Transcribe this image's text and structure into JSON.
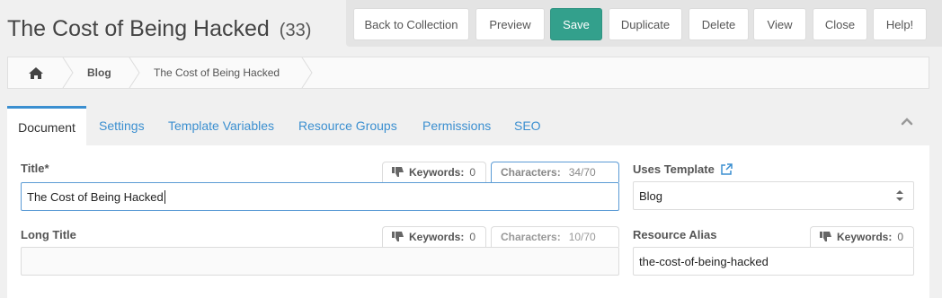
{
  "header": {
    "title": "The Cost of Being Hacked",
    "count": "(33)"
  },
  "toolbar": {
    "back": "Back to Collection",
    "preview": "Preview",
    "save": "Save",
    "duplicate": "Duplicate",
    "delete": "Delete",
    "view": "View",
    "close": "Close",
    "help": "Help!"
  },
  "breadcrumb": {
    "blog": "Blog",
    "current": "The Cost of Being Hacked"
  },
  "tabs": [
    "Document",
    "Settings",
    "Template Variables",
    "Resource Groups",
    "Permissions",
    "SEO"
  ],
  "form": {
    "title": {
      "label": "Title*",
      "value": "The Cost of Being Hacked",
      "keywords_label": "Keywords:",
      "keywords_value": "0",
      "characters_label": "Characters:",
      "characters_value": "34/70"
    },
    "long_title": {
      "label": "Long Title",
      "value": "",
      "keywords_label": "Keywords:",
      "keywords_value": "0",
      "characters_label": "Characters:",
      "characters_value": "10/70"
    },
    "template": {
      "label": "Uses Template",
      "value": "Blog"
    },
    "alias": {
      "label": "Resource Alias",
      "value": "the-cost-of-being-hacked",
      "keywords_label": "Keywords:",
      "keywords_value": "0"
    }
  },
  "colors": {
    "accent": "#3b8fd0",
    "save": "#33a08c"
  },
  "icons": [
    "home-icon",
    "thumbs-down-icon",
    "external-link-icon",
    "select-arrows-icon",
    "chevron-up-icon"
  ]
}
